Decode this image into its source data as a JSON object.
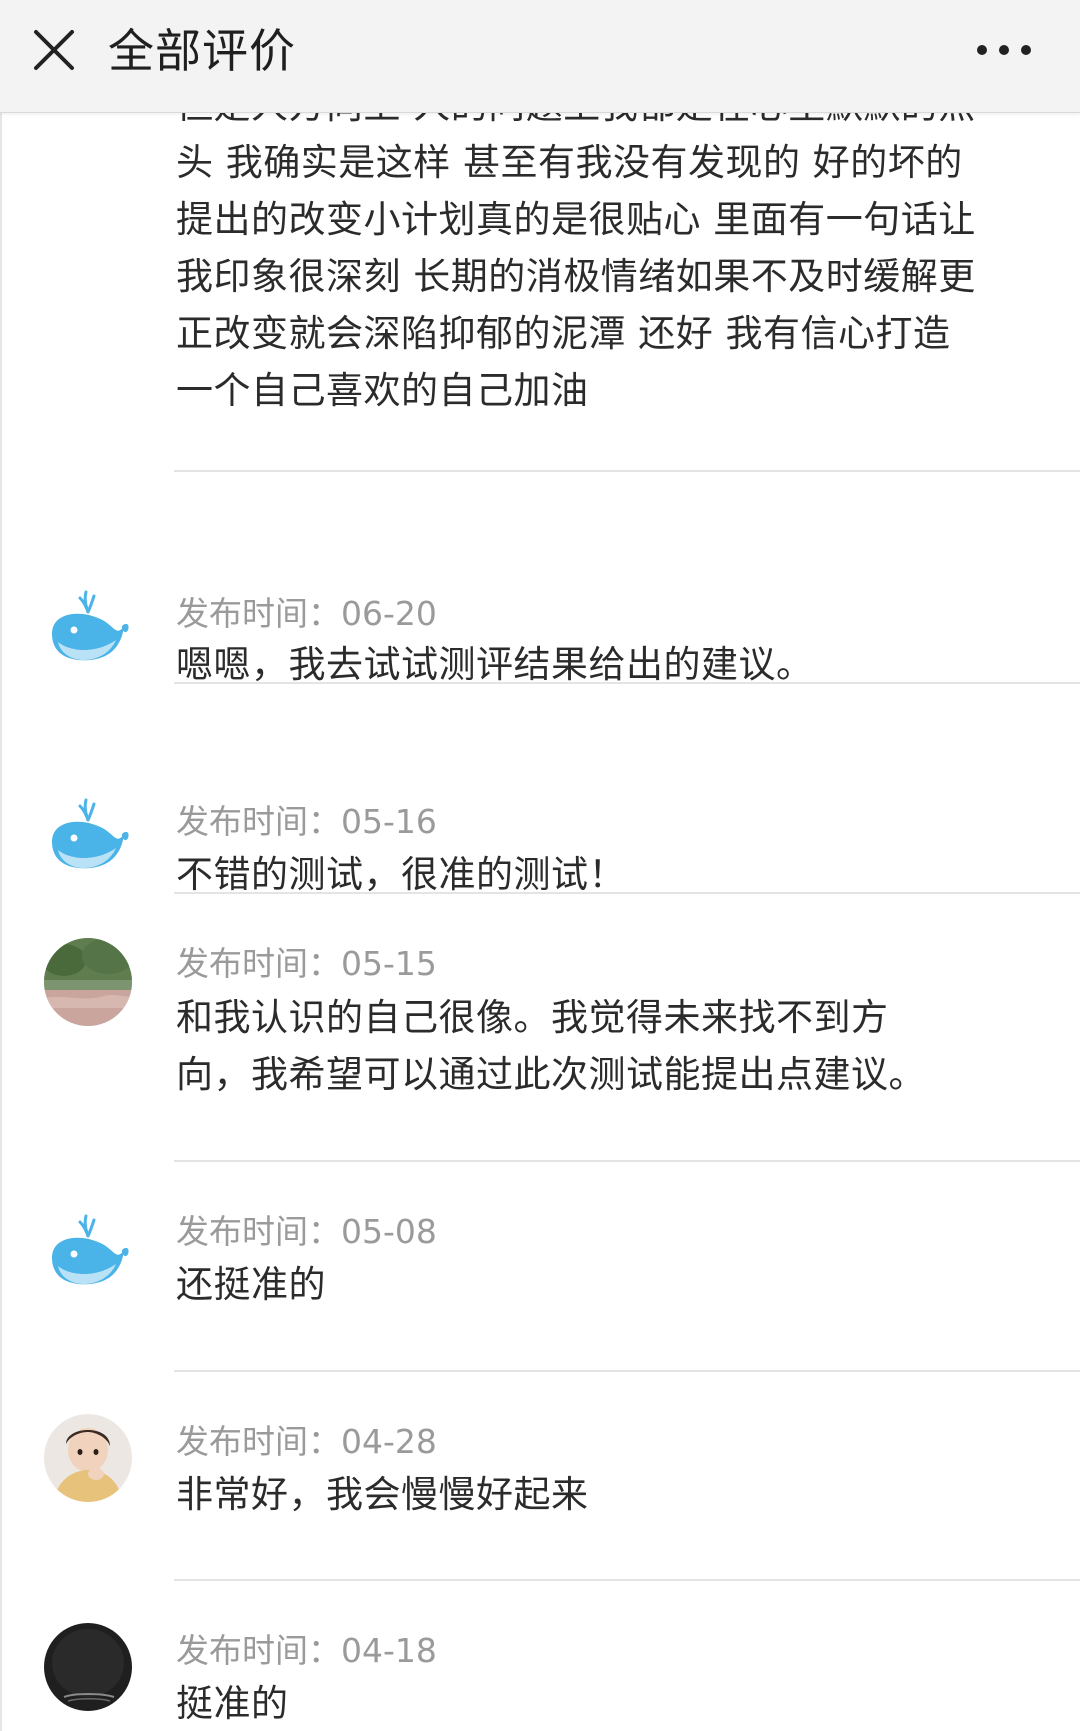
{
  "header": {
    "title": "全部评价",
    "close_icon": "close-icon",
    "more_icon": "more-dots-icon"
  },
  "first_comment": {
    "text": "但是人方向上 人的问题上我都是在心里默默的点头 我确实是这样 甚至有我没有发现的 好的坏的 提出的改变小计划真的是很贴心 里面有一句话让我印象很深刻 长期的消极情绪如果不及时缓解更正改变就会深陷抑郁的泥潭 还好 我有信心打造一个自己喜欢的自己加油"
  },
  "comments": [
    {
      "avatar": "whale-avatar",
      "time_label": "发布时间：",
      "date": "06-20",
      "text": "嗯嗯，我去试试测评结果给出的建议。"
    },
    {
      "avatar": "whale-avatar",
      "time_label": "发布时间：",
      "date": "05-16",
      "text": "不错的测试，很准的测试！"
    },
    {
      "avatar": "landscape-photo-avatar",
      "time_label": "发布时间：",
      "date": "05-15",
      "text": "和我认识的自己很像。我觉得未来找不到方向，我希望可以通过此次测试能提出点建议。"
    },
    {
      "avatar": "whale-avatar",
      "time_label": "发布时间：",
      "date": "05-08",
      "text": "还挺准的"
    },
    {
      "avatar": "child-photo-avatar",
      "time_label": "发布时间：",
      "date": "04-28",
      "text": "非常好，我会慢慢好起来"
    },
    {
      "avatar": "dark-photo-avatar",
      "time_label": "发布时间：",
      "date": "04-18",
      "text": "挺准的"
    }
  ],
  "colors": {
    "header_bg": "#f3f3f3",
    "text": "#2b2b2b",
    "muted": "#9a9a9a",
    "whale": "#4ab3e8",
    "divider": "#e4e4e4"
  }
}
